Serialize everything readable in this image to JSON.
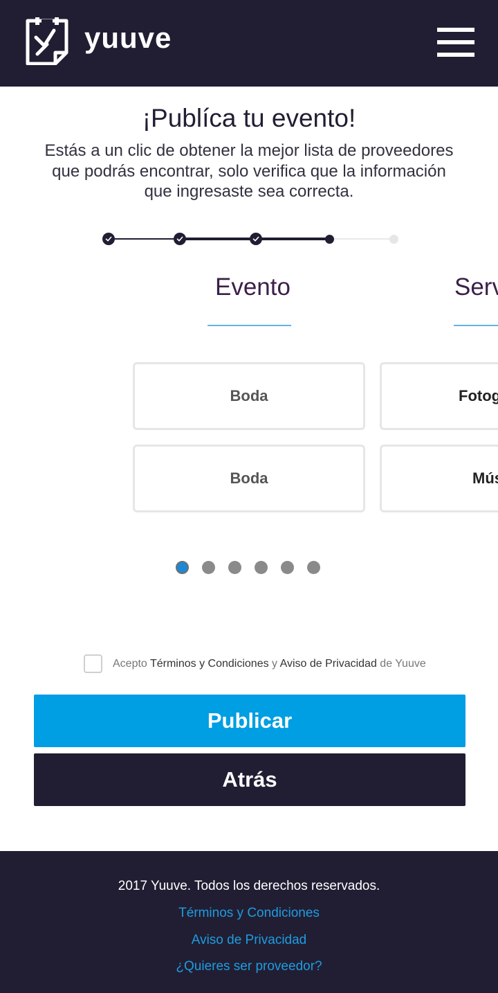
{
  "header": {
    "brand": "yuuve",
    "menu_icon": "hamburger-menu-icon",
    "logo_icon": "clipboard-check-icon",
    "background": "#211e33"
  },
  "intro": {
    "title": "¡Publíca tu evento!",
    "subtitle_lines": [
      "Estás a un clic de obtener la mejor lista de proveedores",
      "que podrás encontrar, solo verifica que la información",
      "que ingresaste sea correcta."
    ]
  },
  "stepper": {
    "total_steps": 5,
    "completed_steps": 3,
    "current_step": 4
  },
  "carousel": {
    "columns": [
      {
        "title": "Evento",
        "options": [
          "Boda",
          "Boda"
        ]
      },
      {
        "title": "Serv",
        "options": [
          "Fotog",
          "Mús"
        ]
      }
    ],
    "pages": 6,
    "active_page": 1
  },
  "terms": {
    "prefix": "Acepto",
    "terms_link": "Términos y Condiciones",
    "connector": "y",
    "privacy_link": "Aviso de Privacidad",
    "suffix": "de Yuuve",
    "checked": false
  },
  "actions": {
    "publish_label": "Publicar",
    "back_label": "Atrás",
    "publish_color": "#009ee2",
    "back_color": "#211e33"
  },
  "footer": {
    "copyright": "2017 Yuuve.  Todos los derechos reservados.",
    "links": [
      "Términos y Condiciones",
      "Aviso de Privacidad",
      "¿Quieres ser proveedor?"
    ],
    "link_color": "#1e9ce0"
  }
}
